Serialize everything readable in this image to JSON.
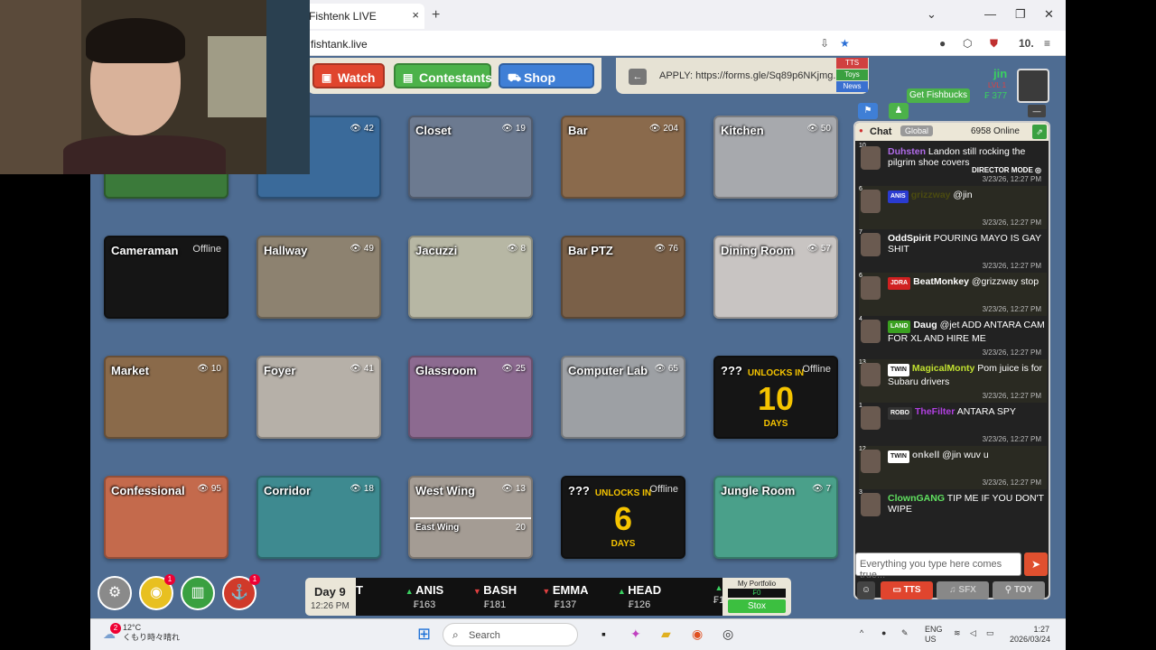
{
  "browser": {
    "tab_title": "Fishtenk LIVE",
    "tab_close": "×",
    "new_tab": "+",
    "url": "fishtank.live",
    "profile_number": "10."
  },
  "nav": {
    "watch": "Watch",
    "contestants": "Contestants",
    "shop": "Shop",
    "apply_text": "APPLY: https://forms.gle/Sq89p6NKjmg...",
    "back_arrow": "←",
    "mini_tts": "TTS",
    "mini_toys": "Toys",
    "mini_news": "News"
  },
  "user": {
    "name": "jin",
    "level": "LVL 1",
    "fishbucks": "₣ 377",
    "get_fishbucks": "Get Fishbucks"
  },
  "tiles": [
    {
      "name": "",
      "views": "",
      "color": "#3b7a3a"
    },
    {
      "name": "",
      "views": "42",
      "color": "#3a6a9a"
    },
    {
      "name": "Closet",
      "views": "19",
      "color": "#6c7a90"
    },
    {
      "name": "Bar",
      "views": "204",
      "color": "#8a6a4c"
    },
    {
      "name": "Kitchen",
      "views": "50",
      "color": "#a7a9ad"
    },
    {
      "name": "Cameraman",
      "offline": "Offline",
      "color": "#151515"
    },
    {
      "name": "Hallway",
      "views": "49",
      "color": "#8d8270"
    },
    {
      "name": "Jacuzzi",
      "views": "8",
      "color": "#b7b7a4"
    },
    {
      "name": "Bar PTZ",
      "views": "76",
      "color": "#7a6048"
    },
    {
      "name": "Dining Room",
      "views": "57",
      "color": "#c8c4c2"
    },
    {
      "name": "Market",
      "views": "10",
      "color": "#8a6a4a"
    },
    {
      "name": "Foyer",
      "views": "41",
      "color": "#b6b0a8"
    },
    {
      "name": "Glassroom",
      "views": "25",
      "color": "#8c6a90"
    },
    {
      "name": "Computer Lab",
      "views": "65",
      "color": "#9da0a4"
    },
    {
      "name": "???",
      "offline": "Offline",
      "unlocks": "UNLOCKS IN",
      "number": "10",
      "days": "DAYS",
      "color": "#151515"
    },
    {
      "name": "Confessional",
      "views": "95",
      "color": "#c46a4c"
    },
    {
      "name": "Corridor",
      "views": "18",
      "color": "#3e8a90"
    },
    {
      "name": "West Wing",
      "views": "13",
      "second_name": "East Wing",
      "second_views": "20",
      "color": "#a49c94"
    },
    {
      "name": "???",
      "offline": "Offline",
      "unlocks": "UNLOCKS IN",
      "number": "6",
      "days": "DAYS",
      "color": "#151515"
    },
    {
      "name": "Jungle Room",
      "views": "7",
      "color": "#4aa08a"
    }
  ],
  "bottom": {
    "day": "Day 9",
    "time": "12:26 PM",
    "ticker": [
      {
        "name": "T",
        "dir": "",
        "price": ""
      },
      {
        "name": "ANIS",
        "dir": "up",
        "price": "₣163"
      },
      {
        "name": "BASH",
        "dir": "down",
        "price": "₣181"
      },
      {
        "name": "EMMA",
        "dir": "down",
        "price": "₣137"
      },
      {
        "name": "HEAD",
        "dir": "up",
        "price": "₣126"
      }
    ],
    "ticker_tail": "₣1",
    "portfolio_label": "My Portfolio",
    "portfolio_value": "₣0",
    "stox": "Stox",
    "badge1": "1",
    "badge2": "1"
  },
  "chat": {
    "title": "Chat",
    "global": "Global",
    "online": "6958 Online",
    "messages": [
      {
        "level": "10",
        "tag": "",
        "user": "Duhsten",
        "user_color": "#b06be8",
        "text": "Landon still rocking the pilgrim shoe covers",
        "extra": "DIRECTOR MODE ◎",
        "time": "3/23/26, 12:27 PM"
      },
      {
        "level": "6",
        "tag": "ANIS",
        "tag_color": "#2a3bd0",
        "user": "grizzway",
        "user_color": "#4b4b10",
        "text": "@jin",
        "extra": "",
        "time": "3/23/26, 12:27 PM"
      },
      {
        "level": "7",
        "tag": "",
        "user": "OddSpirit",
        "user_color": "#ffffff",
        "text": "POURING MAYO IS GAY SHIT",
        "extra": "",
        "time": "3/23/26, 12:27 PM"
      },
      {
        "level": "6",
        "tag": "JDRA",
        "tag_color": "#d02020",
        "user": "BeatMonkey",
        "user_color": "#ffffff",
        "text": "@grizzway stop",
        "extra": "",
        "time": "3/23/26, 12:27 PM"
      },
      {
        "level": "4",
        "tag": "LAND",
        "tag_color": "#3aa020",
        "user": "Daug",
        "user_color": "#ffffff",
        "text": "@jet ADD ANTARA CAM FOR XL AND HIRE ME",
        "extra": "",
        "time": "3/23/26, 12:27 PM"
      },
      {
        "level": "13",
        "tag": "TWIN",
        "tag_color": "#ffffff",
        "user": "MagicalMonty",
        "user_color": "#c0e030",
        "text": "Pom juice is for Subaru drivers",
        "extra": "",
        "time": "3/23/26, 12:27 PM"
      },
      {
        "level": "1",
        "tag": "ROBO",
        "tag_color": "#333333",
        "user": "TheFilter",
        "user_color": "#b040e0",
        "text": "ANTARA SPY",
        "extra": "",
        "time": "3/23/26, 12:27 PM"
      },
      {
        "level": "12",
        "tag": "TWIN",
        "tag_color": "#ffffff",
        "user": "onkell",
        "user_color": "#cccccc",
        "text": "@jin wuv u",
        "extra": "",
        "time": "3/23/26, 12:27 PM"
      },
      {
        "level": "3",
        "tag": "",
        "user": "ClownGANG",
        "user_color": "#60e060",
        "text": "TIP ME IF YOU DON'T WIPE",
        "extra": "",
        "time": ""
      }
    ],
    "input_placeholder": "Everything you type here comes true...",
    "tts": "TTS",
    "sfx": "SFX",
    "toy": "TOY"
  },
  "taskbar": {
    "temp": "12°C",
    "weather": "くもり時々晴れ",
    "weather_badge": "2",
    "search": "Search",
    "lang": "ENG",
    "region": "US",
    "clock": "1:27",
    "date": "2026/03/24"
  }
}
